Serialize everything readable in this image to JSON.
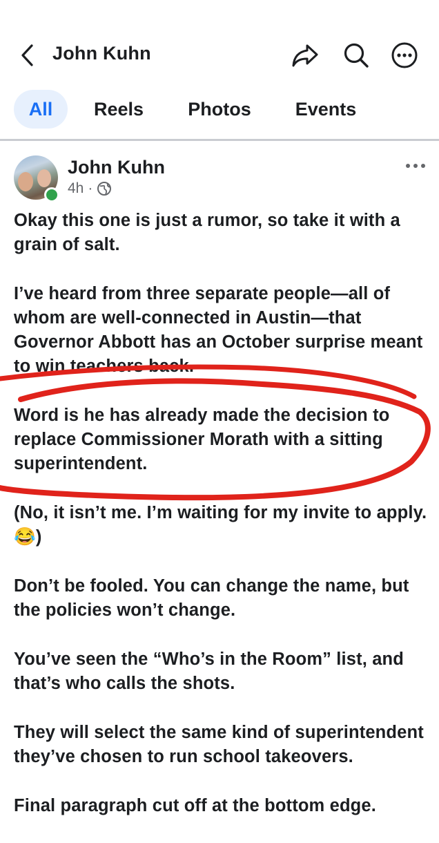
{
  "header": {
    "back_icon": "chevron-left-icon",
    "title": "John Kuhn",
    "share_icon": "share-arrow-icon",
    "search_icon": "search-icon",
    "more_icon": "more-circle-icon"
  },
  "tabs": [
    {
      "label": "All",
      "active": true
    },
    {
      "label": "Reels",
      "active": false
    },
    {
      "label": "Photos",
      "active": false
    },
    {
      "label": "Events",
      "active": false
    }
  ],
  "post": {
    "author": "John Kuhn",
    "time": "4h",
    "separator": "·",
    "privacy_icon": "globe-icon",
    "more_icon": "horizontal-dots-icon",
    "paragraphs": [
      "Okay this one is just a rumor, so take it with a grain of salt.",
      "I’ve heard from three separate people—all of whom are well-connected in Austin—that Governor Abbott has an October surprise meant to win teachers back.",
      "Word is he has already made the decision to replace Commissioner Morath with a sitting superintendent.",
      "(No, it isn’t me. I’m waiting for my invite to apply. 😂)",
      "Don’t be fooled. You can change the name, but the policies won’t change.",
      "You’ve seen the “Who’s in the Room” list, and that’s who calls the shots.",
      "They will select the same kind of superintendent they’ve chosen to run school takeovers.",
      "Final paragraph cut off at the bottom edge."
    ]
  },
  "colors": {
    "accent": "#1a6ff5",
    "tab_active_bg": "#e7f0fd",
    "online": "#31a24c",
    "annotation": "#e0231b"
  }
}
